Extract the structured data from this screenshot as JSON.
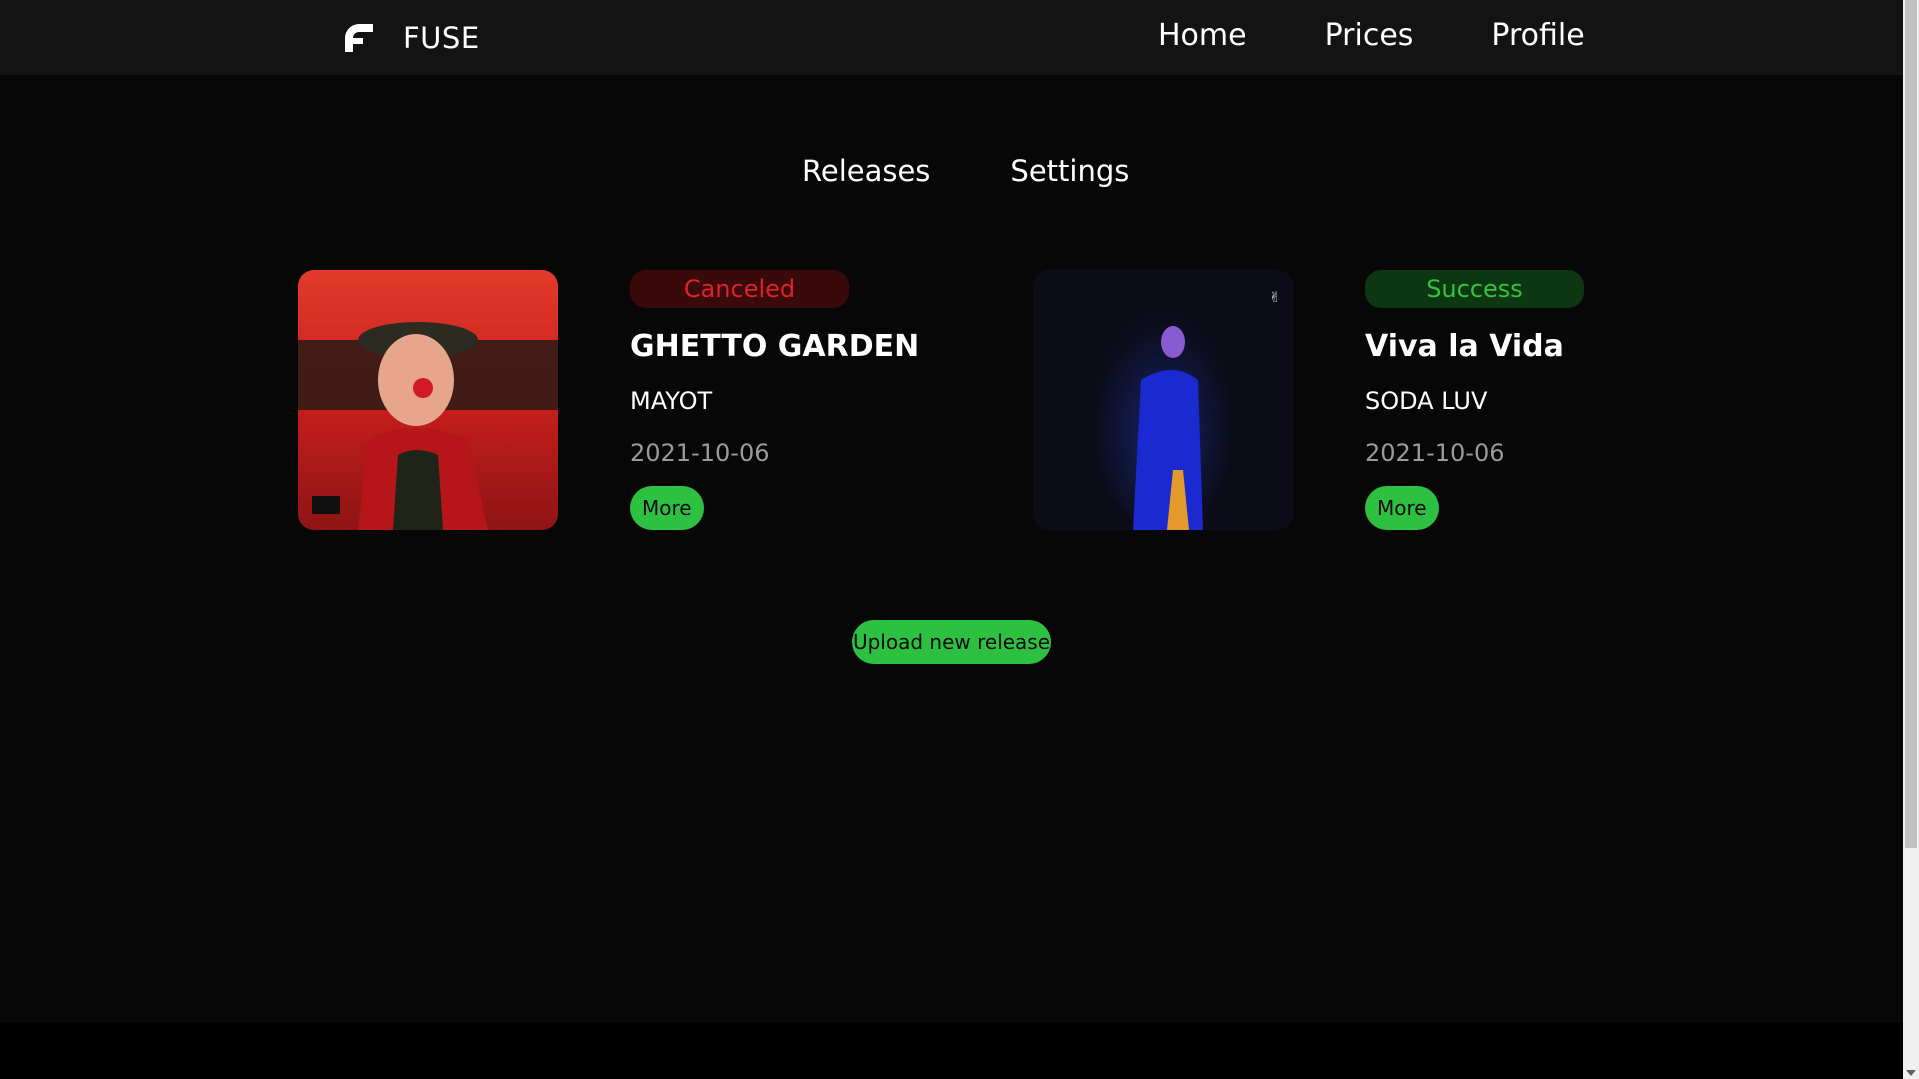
{
  "navbar": {
    "brand": "FUSE",
    "links": [
      {
        "label": "Home"
      },
      {
        "label": "Prices"
      },
      {
        "label": "Profile"
      }
    ]
  },
  "subnav": {
    "items": [
      {
        "label": "Releases"
      },
      {
        "label": "Settings"
      }
    ]
  },
  "releases": [
    {
      "status": "Canceled",
      "title": "GHETTO GARDEN",
      "artist": "MAYOT",
      "date": "2021-10-06",
      "more_label": "More"
    },
    {
      "status": "Success",
      "title": "Viva la Vida",
      "artist": "SODA LUV",
      "date": "2021-10-06",
      "more_label": "More"
    }
  ],
  "upload_label": "Upload new release",
  "colors": {
    "accent": "#2ec040",
    "canceled": "#e0202a",
    "success": "#35c23a"
  }
}
